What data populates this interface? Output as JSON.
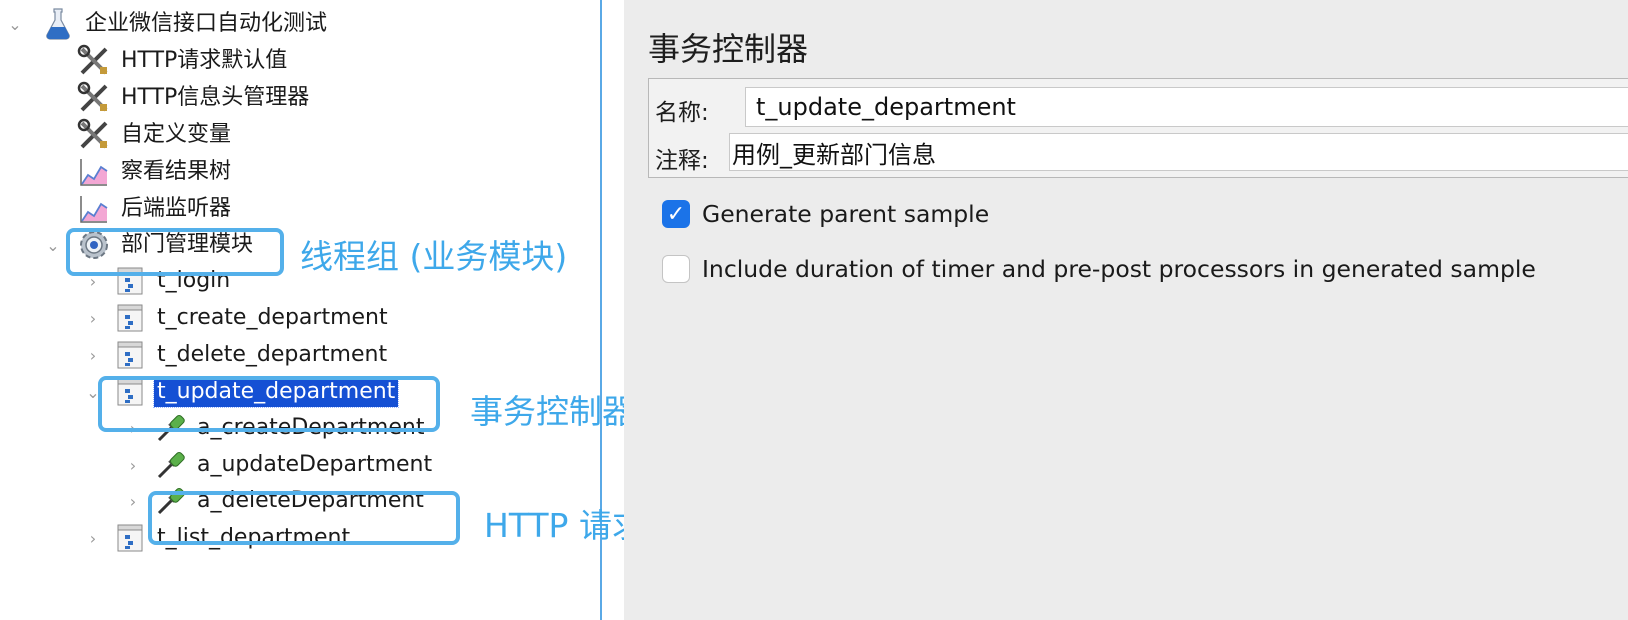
{
  "tree": {
    "root": {
      "label": "企业微信接口自动化测试"
    },
    "config": [
      {
        "label": "HTTP请求默认值",
        "icon": "tools-icon"
      },
      {
        "label": "HTTP信息头管理器",
        "icon": "tools-icon"
      },
      {
        "label": "自定义变量",
        "icon": "tools-icon"
      },
      {
        "label": "察看结果树",
        "icon": "listener-graph-icon"
      },
      {
        "label": "后端监听器",
        "icon": "listener-graph-icon"
      }
    ],
    "thread_group": {
      "label": "部门管理模块"
    },
    "controllers": [
      {
        "label": "t_login"
      },
      {
        "label": "t_create_department"
      },
      {
        "label": "t_delete_department"
      },
      {
        "label": "t_update_department",
        "selected": true
      },
      {
        "label": "t_list_department"
      }
    ],
    "samplers": [
      {
        "label": "a_createDepartment"
      },
      {
        "label": "a_updateDepartment"
      },
      {
        "label": "a_deleteDepartment"
      }
    ]
  },
  "annotations": {
    "thread_group": "线程组 (业务模块)",
    "transaction_controller": "事务控制器 (测试用例)",
    "http_request": "HTTP 请求 (测试步骤)"
  },
  "editor": {
    "title": "事务控制器",
    "name_label": "名称:",
    "name_value": "t_update_department",
    "comment_label": "注释:",
    "comment_value": "用例_更新部门信息",
    "options": [
      {
        "label": "Generate parent sample",
        "checked": true
      },
      {
        "label": "Include duration of timer and pre-post processors in generated sample",
        "checked": false
      }
    ]
  },
  "colors": {
    "accent": "#54b0ea",
    "selection": "#1550d4",
    "checkbox": "#1b73e8"
  }
}
